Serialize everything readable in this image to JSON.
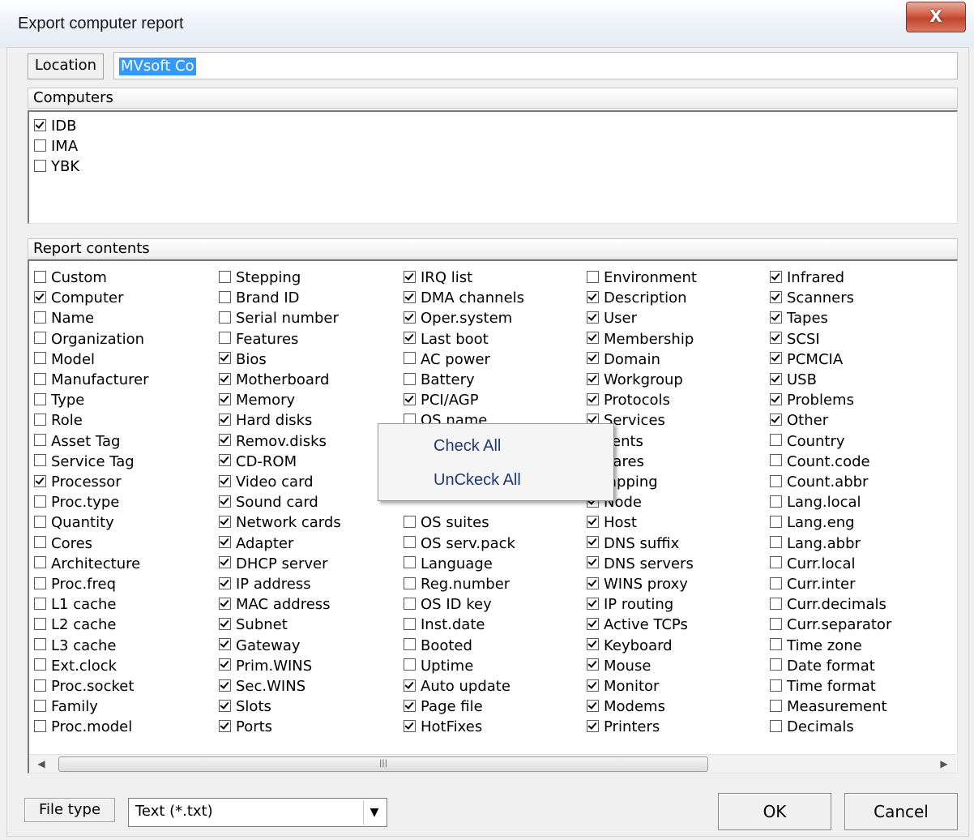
{
  "window": {
    "title": "Export computer report",
    "close_label": "X"
  },
  "location": {
    "button_label": "Location",
    "value": "MVsoft Co"
  },
  "computers": {
    "header": "Computers",
    "items": [
      {
        "label": "IDB",
        "checked": true
      },
      {
        "label": "IMA",
        "checked": false
      },
      {
        "label": "YBK",
        "checked": false
      }
    ]
  },
  "report": {
    "header": "Report contents",
    "columns": [
      [
        {
          "label": "Custom",
          "checked": false
        },
        {
          "label": "Computer",
          "checked": true
        },
        {
          "label": "Name",
          "checked": false
        },
        {
          "label": "Organization",
          "checked": false
        },
        {
          "label": "Model",
          "checked": false
        },
        {
          "label": "Manufacturer",
          "checked": false
        },
        {
          "label": "Type",
          "checked": false
        },
        {
          "label": "Role",
          "checked": false
        },
        {
          "label": "Asset Tag",
          "checked": false
        },
        {
          "label": "Service Tag",
          "checked": false
        },
        {
          "label": "Processor",
          "checked": true
        },
        {
          "label": "Proc.type",
          "checked": false
        },
        {
          "label": "Quantity",
          "checked": false
        },
        {
          "label": "Cores",
          "checked": false
        },
        {
          "label": "Architecture",
          "checked": false
        },
        {
          "label": "Proc.freq",
          "checked": false
        },
        {
          "label": "L1 cache",
          "checked": false
        },
        {
          "label": "L2 cache",
          "checked": false
        },
        {
          "label": "L3 cache",
          "checked": false
        },
        {
          "label": "Ext.clock",
          "checked": false
        },
        {
          "label": "Proc.socket",
          "checked": false
        },
        {
          "label": "Family",
          "checked": false
        },
        {
          "label": "Proc.model",
          "checked": false
        }
      ],
      [
        {
          "label": "Stepping",
          "checked": false
        },
        {
          "label": "Brand ID",
          "checked": false
        },
        {
          "label": "Serial number",
          "checked": false
        },
        {
          "label": "Features",
          "checked": false
        },
        {
          "label": "Bios",
          "checked": true
        },
        {
          "label": "Motherboard",
          "checked": true
        },
        {
          "label": "Memory",
          "checked": true
        },
        {
          "label": "Hard disks",
          "checked": true
        },
        {
          "label": "Remov.disks",
          "checked": true
        },
        {
          "label": "CD-ROM",
          "checked": true
        },
        {
          "label": "Video card",
          "checked": true
        },
        {
          "label": "Sound card",
          "checked": true
        },
        {
          "label": "Network cards",
          "checked": true
        },
        {
          "label": "Adapter",
          "checked": true
        },
        {
          "label": "DHCP server",
          "checked": true
        },
        {
          "label": "IP address",
          "checked": true
        },
        {
          "label": "MAC address",
          "checked": true
        },
        {
          "label": "Subnet",
          "checked": true
        },
        {
          "label": "Gateway",
          "checked": true
        },
        {
          "label": "Prim.WINS",
          "checked": true
        },
        {
          "label": "Sec.WINS",
          "checked": true
        },
        {
          "label": "Slots",
          "checked": true
        },
        {
          "label": "Ports",
          "checked": true
        }
      ],
      [
        {
          "label": "IRQ list",
          "checked": true
        },
        {
          "label": "DMA channels",
          "checked": true
        },
        {
          "label": "Oper.system",
          "checked": true
        },
        {
          "label": "Last boot",
          "checked": true
        },
        {
          "label": "AC power",
          "checked": false
        },
        {
          "label": "Battery",
          "checked": false
        },
        {
          "label": "PCI/AGP",
          "checked": true
        },
        {
          "label": "OS name",
          "checked": false
        },
        {
          "label": "",
          "checked": false
        },
        {
          "label": "",
          "checked": false
        },
        {
          "label": "",
          "checked": false
        },
        {
          "label": "",
          "checked": false
        },
        {
          "label": "OS suites",
          "checked": false
        },
        {
          "label": "OS serv.pack",
          "checked": false
        },
        {
          "label": "Language",
          "checked": false
        },
        {
          "label": "Reg.number",
          "checked": false
        },
        {
          "label": "OS ID key",
          "checked": false
        },
        {
          "label": "Inst.date",
          "checked": false
        },
        {
          "label": "Booted",
          "checked": false
        },
        {
          "label": "Uptime",
          "checked": false
        },
        {
          "label": "Auto update",
          "checked": true
        },
        {
          "label": "Page file",
          "checked": true
        },
        {
          "label": "HotFixes",
          "checked": true
        }
      ],
      [
        {
          "label": "Environment",
          "checked": false
        },
        {
          "label": "Description",
          "checked": true
        },
        {
          "label": "User",
          "checked": true
        },
        {
          "label": "Membership",
          "checked": true
        },
        {
          "label": "Domain",
          "checked": true
        },
        {
          "label": "Workgroup",
          "checked": true
        },
        {
          "label": "Protocols",
          "checked": true
        },
        {
          "label": "Services",
          "checked": true
        },
        {
          "label": "lients",
          "checked": false
        },
        {
          "label": "hares",
          "checked": false
        },
        {
          "label": "lapping",
          "checked": false
        },
        {
          "label": "Node",
          "checked": true
        },
        {
          "label": "Host",
          "checked": true
        },
        {
          "label": "DNS suffix",
          "checked": true
        },
        {
          "label": "DNS servers",
          "checked": true
        },
        {
          "label": "WINS proxy",
          "checked": true
        },
        {
          "label": "IP routing",
          "checked": true
        },
        {
          "label": "Active TCPs",
          "checked": true
        },
        {
          "label": "Keyboard",
          "checked": true
        },
        {
          "label": "Mouse",
          "checked": true
        },
        {
          "label": "Monitor",
          "checked": true
        },
        {
          "label": "Modems",
          "checked": true
        },
        {
          "label": "Printers",
          "checked": true
        }
      ],
      [
        {
          "label": "Infrared",
          "checked": true
        },
        {
          "label": "Scanners",
          "checked": true
        },
        {
          "label": "Tapes",
          "checked": true
        },
        {
          "label": "SCSI",
          "checked": true
        },
        {
          "label": "PCMCIA",
          "checked": true
        },
        {
          "label": "USB",
          "checked": true
        },
        {
          "label": "Problems",
          "checked": true
        },
        {
          "label": "Other",
          "checked": true
        },
        {
          "label": "Country",
          "checked": false
        },
        {
          "label": "Count.code",
          "checked": false
        },
        {
          "label": "Count.abbr",
          "checked": false
        },
        {
          "label": "Lang.local",
          "checked": false
        },
        {
          "label": "Lang.eng",
          "checked": false
        },
        {
          "label": "Lang.abbr",
          "checked": false
        },
        {
          "label": "Curr.local",
          "checked": false
        },
        {
          "label": "Curr.inter",
          "checked": false
        },
        {
          "label": "Curr.decimals",
          "checked": false
        },
        {
          "label": "Curr.separator",
          "checked": false
        },
        {
          "label": "Time zone",
          "checked": false
        },
        {
          "label": "Date format",
          "checked": false
        },
        {
          "label": "Time format",
          "checked": false
        },
        {
          "label": "Measurement",
          "checked": false
        },
        {
          "label": "Decimals",
          "checked": false
        }
      ]
    ]
  },
  "context_menu": {
    "items": [
      "Check All",
      "UnCkeck All"
    ]
  },
  "footer": {
    "file_type_label": "File type",
    "file_type_value": "Text (*.txt)",
    "ok_label": "OK",
    "cancel_label": "Cancel"
  }
}
